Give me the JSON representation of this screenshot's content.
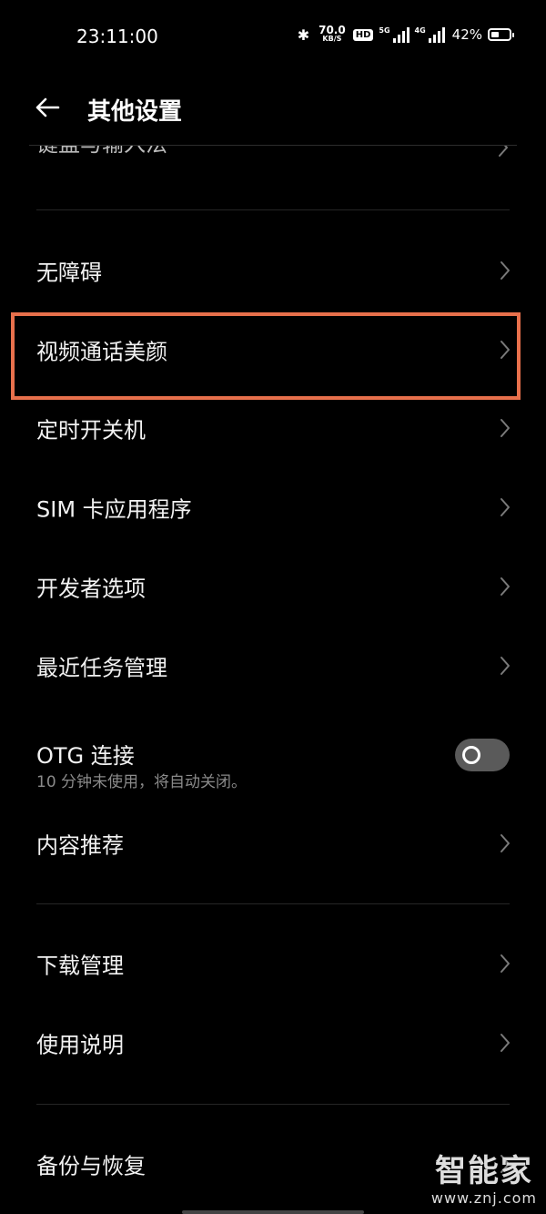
{
  "status_bar": {
    "time": "23:11:00",
    "net_speed_value": "70.0",
    "net_speed_unit": "KB/S",
    "hd_badge": "HD",
    "sim1_label": "5G",
    "sim2_label": "4G",
    "battery_percent": "42%",
    "battery_level": 0.42
  },
  "header": {
    "title": "其他设置"
  },
  "partial_row": {
    "label": "键盘与输入法"
  },
  "rows": [
    {
      "label": "无障碍"
    },
    {
      "label": "视频通话美颜"
    },
    {
      "label": "定时开关机"
    },
    {
      "label": "SIM 卡应用程序"
    },
    {
      "label": "开发者选项"
    },
    {
      "label": "最近任务管理"
    },
    {
      "label": "OTG 连接",
      "subtitle": "10 分钟未使用，将自动关闭。",
      "toggle_on": false
    },
    {
      "label": "内容推荐"
    },
    {
      "label": "下载管理"
    },
    {
      "label": "使用说明"
    },
    {
      "label": "备份与恢复"
    }
  ],
  "highlight_color": "#e8704c",
  "watermark": {
    "brand": "智能家",
    "url": "www.znj.com"
  }
}
